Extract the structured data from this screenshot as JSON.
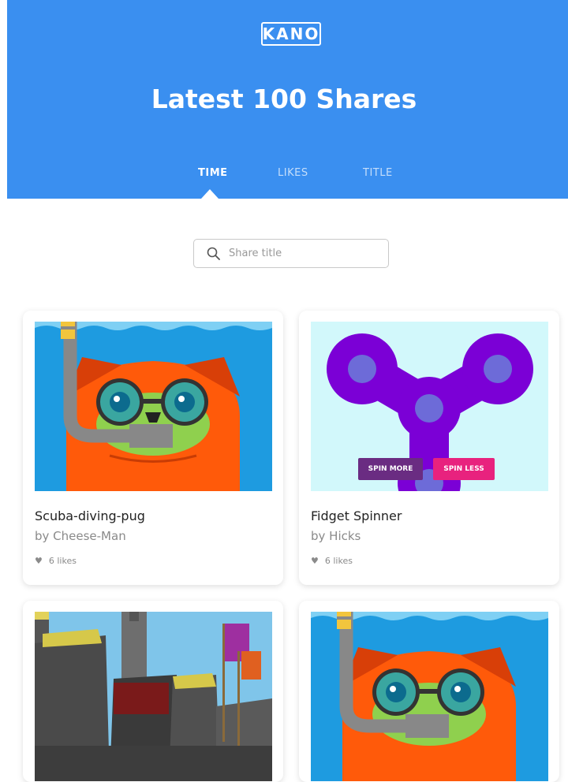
{
  "header": {
    "logo": "KANO",
    "title": "Latest 100 Shares",
    "tabs": [
      {
        "label": "TIME",
        "active": true
      },
      {
        "label": "LIKES",
        "active": false
      },
      {
        "label": "TITLE",
        "active": false
      }
    ]
  },
  "search": {
    "placeholder": "Share title",
    "icon": "search-icon"
  },
  "cards": [
    {
      "title": "Scuba-diving-pug",
      "author": "by Cheese-Man",
      "likes": "6 likes",
      "image": "scuba-pug"
    },
    {
      "title": "Fidget Spinner",
      "author": "by Hicks",
      "likes": "6 likes",
      "image": "fidget-spinner",
      "buttons": [
        "SPIN MORE",
        "SPIN LESS"
      ]
    },
    {
      "title": "",
      "author": "",
      "likes": "",
      "image": "minecraft-castle"
    },
    {
      "title": "",
      "author": "",
      "likes": "",
      "image": "scuba-pug"
    }
  ],
  "colors": {
    "header_bg": "#3a8ff0",
    "spin_more": "#6a2c82",
    "spin_less": "#e8227e"
  }
}
